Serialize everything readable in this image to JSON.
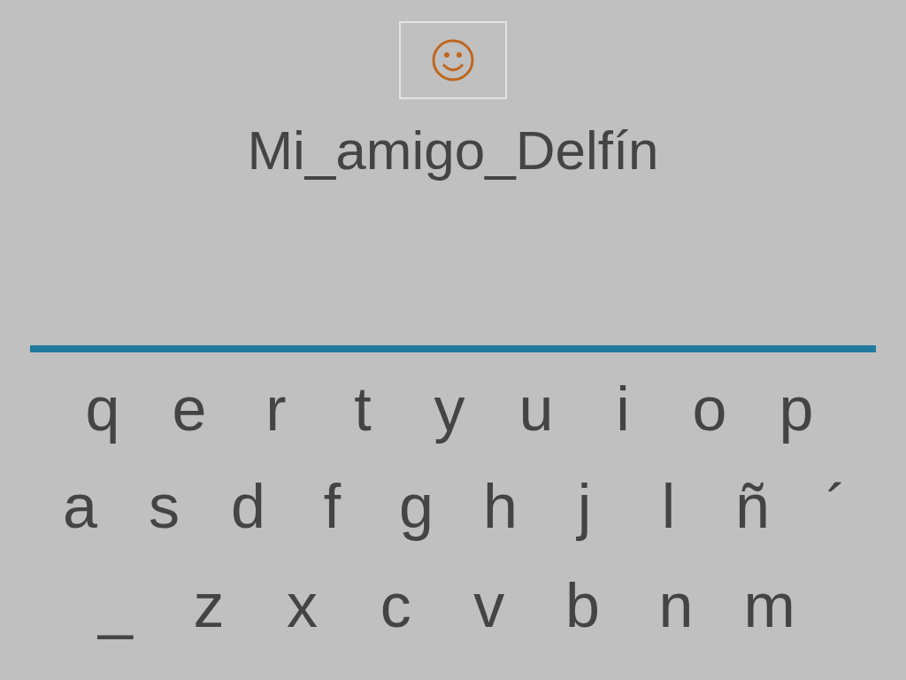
{
  "title": "Mi_amigo_Delfín",
  "keyboard": {
    "rows": [
      [
        "q",
        "e",
        "r",
        "t",
        "y",
        "u",
        "i",
        "o",
        "p"
      ],
      [
        "a",
        "s",
        "d",
        "f",
        "g",
        "h",
        "j",
        "l",
        "ñ",
        "´"
      ],
      [
        "_",
        "z",
        "x",
        "c",
        "v",
        "b",
        "n",
        "m"
      ]
    ]
  }
}
